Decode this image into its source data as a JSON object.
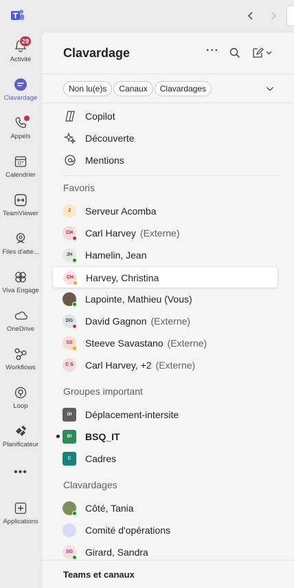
{
  "rail": {
    "items": [
      {
        "label": "Activité",
        "icon": "bell-icon",
        "badge": "29"
      },
      {
        "label": "Clavardage",
        "icon": "chat-icon",
        "active": true
      },
      {
        "label": "Appels",
        "icon": "phone-icon"
      },
      {
        "label": "Calendrier",
        "icon": "calendar-icon"
      },
      {
        "label": "TeamViewer",
        "icon": "teamviewer-icon"
      },
      {
        "label": "Files d'atte...",
        "icon": "queue-icon"
      },
      {
        "label": "Viva Engage",
        "icon": "viva-engage-icon"
      },
      {
        "label": "OneDrive",
        "icon": "onedrive-icon"
      },
      {
        "label": "Workflows",
        "icon": "workflows-icon"
      },
      {
        "label": "Loop",
        "icon": "loop-icon"
      },
      {
        "label": "Planificateur",
        "icon": "planner-icon"
      },
      {
        "label": "Applications",
        "icon": "add-apps-icon"
      }
    ],
    "more": "•••"
  },
  "header": {
    "title": "Clavardage",
    "more": "···"
  },
  "filters": [
    "Non lu(e)s",
    "Canaux",
    "Clavardages"
  ],
  "pinned": [
    "Copilot",
    "Découverte",
    "Mentions"
  ],
  "sections": {
    "favoris": "Favoris",
    "groupes": "Groupes important",
    "clavardages": "Clavardages"
  },
  "favoris": [
    {
      "name": "Serveur Acomba",
      "ext": "",
      "initials": "J",
      "avatarBg": "#fde7c8",
      "avatarFg": "#8a5a00",
      "presence": ""
    },
    {
      "name": "Carl Harvey",
      "ext": "(Externe)",
      "initials": "CH",
      "avatarBg": "#f6d9dc",
      "avatarFg": "#a4262c",
      "presence": "#c4314b"
    },
    {
      "name": "Hamelin, Jean",
      "ext": "",
      "initials": "JH",
      "avatarBg": "#e5e9e2",
      "avatarFg": "#405036",
      "presence": "#13a10e"
    },
    {
      "name": "Harvey, Christina",
      "ext": "",
      "initials": "CH",
      "avatarBg": "#fcdede",
      "avatarFg": "#a4262c",
      "presence": "#f8a800"
    },
    {
      "name": "Lapointe, Mathieu (Vous)",
      "ext": "",
      "initials": "",
      "avatarBg": "#6b5a4c",
      "avatarFg": "#fff",
      "presence": "#13a10e"
    },
    {
      "name": "David Gagnon",
      "ext": "(Externe)",
      "initials": "DG",
      "avatarBg": "#dde3ea",
      "avatarFg": "#37474f",
      "presence": "#c4314b"
    },
    {
      "name": "Steeve Savastano",
      "ext": "(Externe)",
      "initials": "SS",
      "avatarBg": "#fbdad6",
      "avatarFg": "#c5351b",
      "presence": "#f8a800"
    },
    {
      "name": "Carl Harvey, +2",
      "ext": "(Externe)",
      "initials": "C S",
      "avatarBg": "#f6d9dc",
      "avatarFg": "#a4262c",
      "presence": ""
    }
  ],
  "groupes": [
    {
      "name": "Déplacement-intersite",
      "initials": "DI",
      "color": "#605e5c",
      "bold": false
    },
    {
      "name": "BSQ_IT",
      "initials": "BI",
      "color": "#2e8b57",
      "bold": true
    },
    {
      "name": "Cadres",
      "initials": "C",
      "color": "#1a7f7f",
      "bold": false
    }
  ],
  "clavardages": [
    {
      "name": "Côté, Tania",
      "initials": "",
      "avatarBg": "#7a8f5c",
      "avatarFg": "#fff",
      "presence": "#13a10e"
    },
    {
      "name": "Comité d'opérations",
      "initials": "",
      "avatarBg": "#d9dcf7",
      "avatarFg": "#5b5fc7",
      "presence": ""
    },
    {
      "name": "Girard, Sandra",
      "initials": "SG",
      "avatarBg": "#fcdbe3",
      "avatarFg": "#b4235e",
      "presence": "#13a10e"
    }
  ],
  "footer": {
    "title": "Teams et canaux"
  },
  "colors": {
    "accent": "#5b5fc7",
    "badge": "#c4314b"
  }
}
